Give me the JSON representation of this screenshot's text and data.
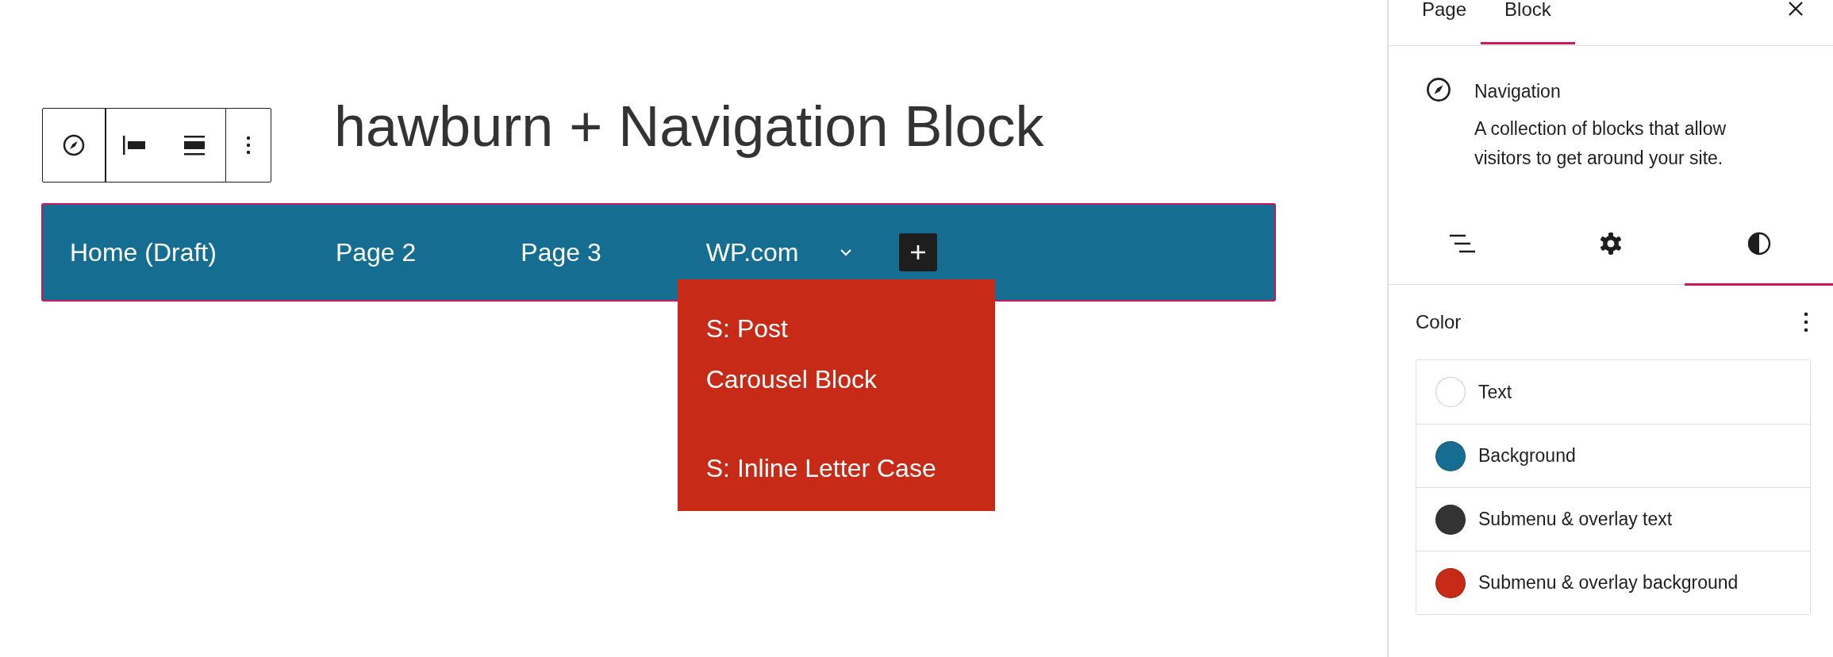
{
  "title": "hawburn + Navigation Block",
  "block_toolbar": {
    "tools": [
      {
        "kind": "compass"
      },
      {
        "kind": "justify-left"
      },
      {
        "kind": "justify-stretch"
      },
      {
        "kind": "more"
      }
    ]
  },
  "navigation": {
    "items": [
      {
        "label": "Home (Draft)"
      },
      {
        "label": "Page 2"
      },
      {
        "label": "Page 3"
      },
      {
        "label": "WP.com",
        "expanded": true,
        "submenu": [
          "S: Post\nCarousel Block",
          "S: Inline Letter Case"
        ]
      }
    ]
  },
  "sidebar": {
    "tabs": [
      {
        "label": "Page",
        "selected": false
      },
      {
        "label": "Block",
        "selected": true
      }
    ],
    "block_card": {
      "name": "Navigation",
      "description": "A collection of blocks that allow visitors to get around your site."
    },
    "inspector_tabs": [
      {
        "kind": "list",
        "selected": false
      },
      {
        "kind": "settings",
        "selected": false
      },
      {
        "kind": "styles",
        "selected": true
      }
    ],
    "color_panel": {
      "title": "Color",
      "items": [
        {
          "label": "Text",
          "color": "#ffffff"
        },
        {
          "label": "Background",
          "color": "#156d91"
        },
        {
          "label": "Submenu & overlay text",
          "color": "#333333"
        },
        {
          "label": "Submenu & overlay background",
          "color": "#c72a16"
        }
      ]
    }
  }
}
